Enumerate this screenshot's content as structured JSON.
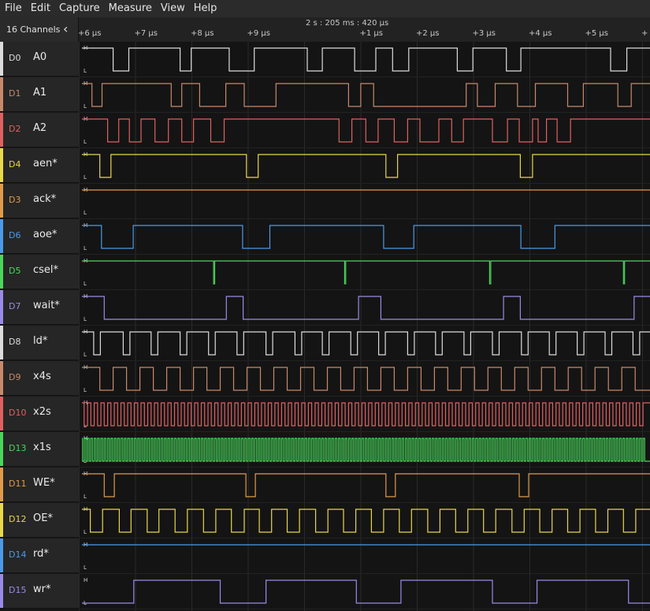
{
  "menu": [
    "File",
    "Edit",
    "Capture",
    "Measure",
    "View",
    "Help"
  ],
  "header": {
    "channel_count": "16 Channels",
    "time_info": "2 s : 205 ms : 420 µs",
    "ticks": [
      {
        "label": "+6 µs",
        "pos": 0.0
      },
      {
        "label": "+7 µs",
        "pos": 1.0
      },
      {
        "label": "+8 µs",
        "pos": 2.0
      },
      {
        "label": "+9 µs",
        "pos": 3.0
      },
      {
        "label": "+1 µs",
        "pos": 5.0
      },
      {
        "label": "+2 µs",
        "pos": 6.0
      },
      {
        "label": "+3 µs",
        "pos": 7.0
      },
      {
        "label": "+4 µs",
        "pos": 8.0
      },
      {
        "label": "+5 µs",
        "pos": 9.0
      },
      {
        "label": "+",
        "pos": 10.0
      }
    ]
  },
  "channels": [
    {
      "id": "D0",
      "name": "A0",
      "color": "#dcdcdc",
      "edges": [
        0.56,
        0.84,
        1.76,
        1.96,
        2.64,
        3.09,
        4.04,
        4.31,
        4.89,
        5.27,
        5.57,
        5.86,
        6.73,
        7.01,
        7.61,
        7.87,
        9.48,
        9.77
      ]
    },
    {
      "id": "D1",
      "name": "A1",
      "color": "#c8896a",
      "edges": [
        0.18,
        0.36,
        1.6,
        1.79,
        2.11,
        2.58,
        2.91,
        3.48,
        4.78,
        5.0,
        5.23,
        6.89,
        7.09,
        7.41,
        7.81,
        8.13,
        8.71,
        8.99,
        9.61,
        9.85
      ]
    },
    {
      "id": "D2",
      "name": "A2",
      "color": "#e06060",
      "edges": [
        0.46,
        0.66,
        0.85,
        1.06,
        1.31,
        1.55,
        1.79,
        2.0,
        2.31,
        2.55,
        4.61,
        4.84,
        5.09,
        5.31,
        5.6,
        5.84,
        6.06,
        6.4,
        6.63,
        6.84,
        7.36,
        7.63,
        7.84,
        8.08,
        8.18,
        8.33,
        8.52,
        8.76
      ]
    },
    {
      "id": "D4",
      "name": "aen*",
      "color": "#e8d84a",
      "edges": [
        0.32,
        0.52,
        2.95,
        3.16,
        5.45,
        5.66,
        7.86,
        8.08
      ]
    },
    {
      "id": "D3",
      "name": "ack*",
      "color": "#e09a4a",
      "edges": []
    },
    {
      "id": "D6",
      "name": "aoe*",
      "color": "#4a9ae8",
      "edges": [
        0.35,
        0.92,
        2.88,
        3.37,
        5.41,
        5.95,
        7.87,
        8.48
      ]
    },
    {
      "id": "D5",
      "name": "csel*",
      "color": "#4ad65a",
      "edges": [
        2.36,
        2.38,
        4.71,
        4.73,
        7.31,
        7.33,
        9.71,
        9.73
      ]
    },
    {
      "id": "D7",
      "name": "wait*",
      "color": "#9a8ae8",
      "edges": [
        0.4,
        2.59,
        2.89,
        4.96,
        5.36,
        7.56,
        7.86,
        9.9
      ]
    },
    {
      "id": "D8",
      "name": "ld*",
      "color": "#dcdcdc",
      "edges": [
        0.21,
        0.33,
        0.74,
        0.86,
        1.24,
        1.36,
        1.76,
        1.88,
        2.27,
        2.39,
        2.78,
        2.9,
        3.3,
        3.42,
        3.82,
        3.94,
        4.31,
        4.43,
        4.82,
        4.94,
        5.32,
        5.44,
        5.84,
        5.96,
        6.34,
        6.46,
        6.85,
        6.97,
        7.36,
        7.48,
        7.88,
        8.0,
        8.38,
        8.5,
        8.88,
        9.0,
        9.38,
        9.5,
        9.88,
        10.0
      ]
    },
    {
      "id": "D9",
      "name": "x4s",
      "color": "#c8896a",
      "edges": [
        0.32,
        0.56,
        0.8,
        1.04,
        1.28,
        1.52,
        1.76,
        2.0,
        2.24,
        2.48,
        2.72,
        2.96,
        3.2,
        3.44,
        3.68,
        3.92,
        4.16,
        4.4,
        4.64,
        4.88,
        5.12,
        5.36,
        5.6,
        5.84,
        6.08,
        6.32,
        6.56,
        6.8,
        7.04,
        7.28,
        7.52,
        7.76,
        8.0,
        8.24,
        8.48,
        8.72,
        8.96,
        9.2,
        9.44,
        9.68,
        9.92
      ]
    },
    {
      "id": "D10",
      "name": "x2s",
      "color": "#e06060",
      "period": 0.12,
      "phase": 0.04,
      "dense": true
    },
    {
      "id": "D13",
      "name": "x1s",
      "color": "#4ad65a",
      "period": 0.06,
      "phase": 0.01,
      "dense": true
    },
    {
      "id": "D11",
      "name": "WE*",
      "color": "#e09a4a",
      "edges": [
        0.4,
        0.58,
        2.94,
        3.11,
        5.45,
        5.62,
        7.84,
        8.01
      ]
    },
    {
      "id": "D12",
      "name": "OE*",
      "color": "#e8d84a",
      "edges": [
        0.15,
        0.37,
        0.67,
        0.88,
        1.17,
        1.38,
        1.67,
        1.89,
        2.18,
        2.4,
        2.68,
        2.91,
        3.18,
        3.4,
        3.68,
        3.9,
        4.19,
        4.41,
        4.69,
        4.91,
        5.19,
        5.41,
        5.69,
        5.91,
        6.2,
        6.42,
        6.7,
        6.92,
        7.2,
        7.42,
        7.71,
        7.93,
        8.21,
        8.43,
        8.71,
        8.93,
        9.21,
        9.43,
        9.71,
        9.93
      ]
    },
    {
      "id": "D14",
      "name": "rd*",
      "color": "#4a9ae8",
      "edges": []
    },
    {
      "id": "D15",
      "name": "wr*",
      "color": "#9a8ae8",
      "startLow": true,
      "edges": [
        0.93,
        2.48,
        3.3,
        4.92,
        5.72,
        7.36,
        8.16,
        9.8
      ]
    }
  ],
  "levels": {
    "high": "H",
    "low": "L"
  }
}
